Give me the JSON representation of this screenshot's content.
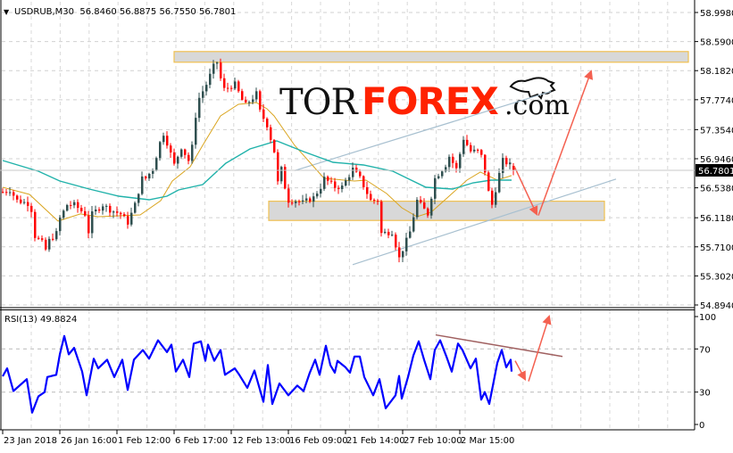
{
  "header": {
    "symbol_line": "USDRUB,M30  56.8460 56.8875 56.7550 56.7801",
    "current_price_label": "56.7801"
  },
  "logo": {
    "part1": "TOR",
    "part2": "FOREX",
    "part3": ".com"
  },
  "colors": {
    "bull": "#2f4f4f",
    "bear": "#ff0000",
    "ma_fast": "#daa520",
    "ma_slow": "#20b2aa",
    "rsi": "#0000ff",
    "zone_border": "#f0c050",
    "zone_fill": "#d8d8d8",
    "channel": "#a8c0d0",
    "arrow": "#f46050",
    "rsi_trend": "#a06060",
    "logo_red": "#ff2200"
  },
  "chart_data": [
    {
      "type": "candlestick",
      "title": "USDRUB,M30",
      "ohlc_last": {
        "open": 56.846,
        "high": 56.8875,
        "low": 56.755,
        "close": 56.7801
      },
      "ylim": [
        54.894,
        58.998
      ],
      "yticks": [
        "58.9980",
        "58.5900",
        "58.1820",
        "57.7740",
        "57.3540",
        "56.9460",
        "56.5380",
        "56.1180",
        "55.7100",
        "55.3020",
        "54.8940"
      ],
      "xticks": [
        {
          "i": 0,
          "label": "23 Jan 2018"
        },
        {
          "i": 16,
          "label": "26 Jan 16:00"
        },
        {
          "i": 32,
          "label": "1 Feb 12:00"
        },
        {
          "i": 48,
          "label": "6 Feb 17:00"
        },
        {
          "i": 64,
          "label": "12 Feb 13:00"
        },
        {
          "i": 80,
          "label": "16 Feb 09:00"
        },
        {
          "i": 96,
          "label": "21 Feb 14:00"
        },
        {
          "i": 112,
          "label": "27 Feb 10:00"
        },
        {
          "i": 128,
          "label": "2 Mar 15:00"
        }
      ],
      "close_keypoints": [
        [
          0,
          56.48
        ],
        [
          2,
          56.51
        ],
        [
          4,
          56.36
        ],
        [
          7,
          56.32
        ],
        [
          8,
          56.23
        ],
        [
          9,
          55.86
        ],
        [
          11,
          55.77
        ],
        [
          12,
          55.67
        ],
        [
          13,
          55.8
        ],
        [
          15,
          55.9
        ],
        [
          16,
          56.11
        ],
        [
          18,
          56.3
        ],
        [
          20,
          56.3
        ],
        [
          23,
          56.17
        ],
        [
          24,
          55.92
        ],
        [
          25,
          56.17
        ],
        [
          28,
          56.3
        ],
        [
          30,
          56.23
        ],
        [
          33,
          56.17
        ],
        [
          35,
          56.05
        ],
        [
          37,
          56.3
        ],
        [
          39,
          56.67
        ],
        [
          40,
          56.67
        ],
        [
          42,
          56.8
        ],
        [
          44,
          57.17
        ],
        [
          45,
          57.3
        ],
        [
          46,
          57.17
        ],
        [
          48,
          56.86
        ],
        [
          50,
          57.11
        ],
        [
          52,
          56.92
        ],
        [
          53,
          57.11
        ],
        [
          54,
          57.55
        ],
        [
          55,
          57.8
        ],
        [
          57,
          57.99
        ],
        [
          59,
          58.24
        ],
        [
          60,
          58.3
        ],
        [
          61,
          58.07
        ],
        [
          62,
          57.92
        ],
        [
          65,
          57.99
        ],
        [
          67,
          57.77
        ],
        [
          68,
          57.7
        ],
        [
          70,
          57.8
        ],
        [
          71,
          57.86
        ],
        [
          72,
          57.61
        ],
        [
          74,
          57.42
        ],
        [
          75,
          57.23
        ],
        [
          76,
          57.05
        ],
        [
          77,
          56.61
        ],
        [
          78,
          56.8
        ],
        [
          79,
          56.55
        ],
        [
          80,
          56.36
        ],
        [
          82,
          56.36
        ],
        [
          84,
          56.33
        ],
        [
          87,
          56.4
        ],
        [
          89,
          56.55
        ],
        [
          90,
          56.67
        ],
        [
          93,
          56.55
        ],
        [
          95,
          56.55
        ],
        [
          98,
          56.8
        ],
        [
          100,
          56.67
        ],
        [
          103,
          56.36
        ],
        [
          105,
          56.36
        ],
        [
          106,
          55.9
        ],
        [
          109,
          55.92
        ],
        [
          111,
          55.55
        ],
        [
          114,
          55.92
        ],
        [
          116,
          56.36
        ],
        [
          119,
          56.17
        ],
        [
          121,
          56.67
        ],
        [
          124,
          56.86
        ],
        [
          125,
          56.98
        ],
        [
          127,
          56.8
        ],
        [
          129,
          57.23
        ],
        [
          131,
          57.05
        ],
        [
          133,
          57.05
        ],
        [
          134,
          56.98
        ],
        [
          135,
          56.77
        ],
        [
          136,
          56.48
        ],
        [
          137,
          56.3
        ],
        [
          139,
          56.73
        ],
        [
          140,
          56.92
        ],
        [
          142,
          56.86
        ],
        [
          143,
          56.78
        ]
      ],
      "series": [
        {
          "name": "MA fast",
          "points": [
            [
              0,
              56.546
            ],
            [
              7.5,
              56.446
            ],
            [
              15.5,
              56.071
            ],
            [
              21.75,
              56.171
            ],
            [
              26.75,
              56.133
            ],
            [
              38.5,
              56.158
            ],
            [
              44.25,
              56.358
            ],
            [
              47.5,
              56.633
            ],
            [
              52.5,
              56.834
            ],
            [
              56,
              57.134
            ],
            [
              61,
              57.547
            ],
            [
              66,
              57.709
            ],
            [
              71,
              57.734
            ],
            [
              74,
              57.647
            ],
            [
              76,
              57.547
            ],
            [
              81.75,
              57.134
            ],
            [
              90,
              56.671
            ],
            [
              98.5,
              56.633
            ],
            [
              101.75,
              56.646
            ],
            [
              107.5,
              56.458
            ],
            [
              111.75,
              56.258
            ],
            [
              116,
              56.133
            ],
            [
              120,
              56.196
            ],
            [
              125,
              56.421
            ],
            [
              130,
              56.646
            ],
            [
              133.75,
              56.759
            ],
            [
              138.5,
              56.646
            ],
            [
              142.5,
              56.709
            ]
          ]
        },
        {
          "name": "MA slow",
          "points": [
            [
              0,
              56.921
            ],
            [
              10,
              56.771
            ],
            [
              16,
              56.633
            ],
            [
              24.25,
              56.521
            ],
            [
              32.5,
              56.421
            ],
            [
              41,
              56.371
            ],
            [
              46,
              56.421
            ],
            [
              49.25,
              56.508
            ],
            [
              56,
              56.583
            ],
            [
              62.5,
              56.884
            ],
            [
              69.25,
              57.084
            ],
            [
              76.75,
              57.196
            ],
            [
              84.25,
              57.046
            ],
            [
              92.5,
              56.896
            ],
            [
              101,
              56.859
            ],
            [
              109.25,
              56.771
            ],
            [
              118.5,
              56.546
            ],
            [
              126,
              56.521
            ],
            [
              131.75,
              56.608
            ],
            [
              136.75,
              56.646
            ],
            [
              142.5,
              56.646
            ]
          ]
        }
      ],
      "zones": [
        {
          "name": "resistance",
          "from_i": 48,
          "to_i": 192,
          "top": 58.45,
          "bottom": 58.3
        },
        {
          "name": "support",
          "from_i": 74.5,
          "to_i": 168.5,
          "top": 56.35,
          "bottom": 56.08
        }
      ],
      "channel_lines": [
        {
          "name": "upper",
          "from": [
            81.75,
            56.78
          ],
          "to": [
            153.5,
            57.89
          ]
        },
        {
          "name": "lower",
          "from": [
            98,
            55.46
          ],
          "to": [
            171.75,
            56.66
          ]
        }
      ],
      "forecast_arrows": [
        {
          "from": [
            143.25,
            56.84
          ],
          "to": [
            149.5,
            56.17
          ]
        },
        {
          "from": [
            150,
            56.15
          ],
          "to": [
            164.75,
            58.17
          ]
        }
      ]
    },
    {
      "type": "line",
      "title": "RSI(13)",
      "label": "RSI(13) 49.8824",
      "ylim": [
        0,
        100
      ],
      "yticks": [
        "100",
        "70",
        "30",
        "0"
      ],
      "levels": [
        70,
        30
      ],
      "points": [
        [
          0,
          44.6
        ],
        [
          1.25,
          52
        ],
        [
          3,
          31
        ],
        [
          6.75,
          42
        ],
        [
          8.25,
          11
        ],
        [
          10,
          26
        ],
        [
          11.75,
          30
        ],
        [
          12.5,
          44
        ],
        [
          15,
          46
        ],
        [
          16,
          65
        ],
        [
          17.25,
          82
        ],
        [
          18.5,
          65
        ],
        [
          20,
          71
        ],
        [
          22.25,
          49
        ],
        [
          23.5,
          27
        ],
        [
          25.5,
          61
        ],
        [
          26.75,
          52
        ],
        [
          29.25,
          60
        ],
        [
          31.25,
          44
        ],
        [
          33.5,
          60
        ],
        [
          35,
          32
        ],
        [
          36.75,
          60
        ],
        [
          39.25,
          69
        ],
        [
          41,
          61
        ],
        [
          43.5,
          78
        ],
        [
          46,
          67
        ],
        [
          47.25,
          74
        ],
        [
          48.5,
          49
        ],
        [
          50.5,
          60
        ],
        [
          52.25,
          44
        ],
        [
          53.5,
          75
        ],
        [
          55.5,
          77
        ],
        [
          56.75,
          59
        ],
        [
          57.5,
          74
        ],
        [
          59.25,
          59
        ],
        [
          61,
          69
        ],
        [
          62.25,
          46
        ],
        [
          65,
          52
        ],
        [
          66.25,
          46
        ],
        [
          68.5,
          34
        ],
        [
          70.5,
          50
        ],
        [
          73,
          21
        ],
        [
          74.25,
          55
        ],
        [
          75.5,
          19
        ],
        [
          77.5,
          38
        ],
        [
          80,
          27
        ],
        [
          82.5,
          36
        ],
        [
          84.25,
          31
        ],
        [
          86,
          48
        ],
        [
          87.5,
          60
        ],
        [
          88.75,
          46
        ],
        [
          90.5,
          73
        ],
        [
          91.75,
          55
        ],
        [
          93,
          48
        ],
        [
          93.75,
          59
        ],
        [
          96,
          53
        ],
        [
          97.25,
          48
        ],
        [
          98.5,
          63
        ],
        [
          100,
          63
        ],
        [
          101.25,
          44
        ],
        [
          103.75,
          27
        ],
        [
          105.5,
          42
        ],
        [
          107.25,
          15
        ],
        [
          110,
          27
        ],
        [
          111,
          45
        ],
        [
          111.75,
          24
        ],
        [
          113.5,
          44
        ],
        [
          115,
          64
        ],
        [
          116.5,
          77
        ],
        [
          118,
          60
        ],
        [
          119.75,
          42
        ],
        [
          121,
          69
        ],
        [
          122.5,
          78
        ],
        [
          124.25,
          63
        ],
        [
          125.75,
          49
        ],
        [
          127.5,
          75
        ],
        [
          128.75,
          69
        ],
        [
          131,
          52
        ],
        [
          132.5,
          61
        ],
        [
          134,
          23
        ],
        [
          135,
          30
        ],
        [
          136.25,
          19
        ],
        [
          137.5,
          40
        ],
        [
          138.5,
          57
        ],
        [
          139.75,
          69
        ],
        [
          141,
          53
        ],
        [
          142.25,
          60
        ],
        [
          142.5,
          49
        ]
      ],
      "trend_line": {
        "from": [
          121.25,
          83
        ],
        "to": [
          156.75,
          63
        ]
      },
      "forecast_arrows": [
        {
          "from": [
            143.5,
            59
          ],
          "to": [
            146.25,
            42
          ]
        },
        {
          "from": [
            147.25,
            40
          ],
          "to": [
            153,
            100
          ]
        }
      ]
    }
  ]
}
